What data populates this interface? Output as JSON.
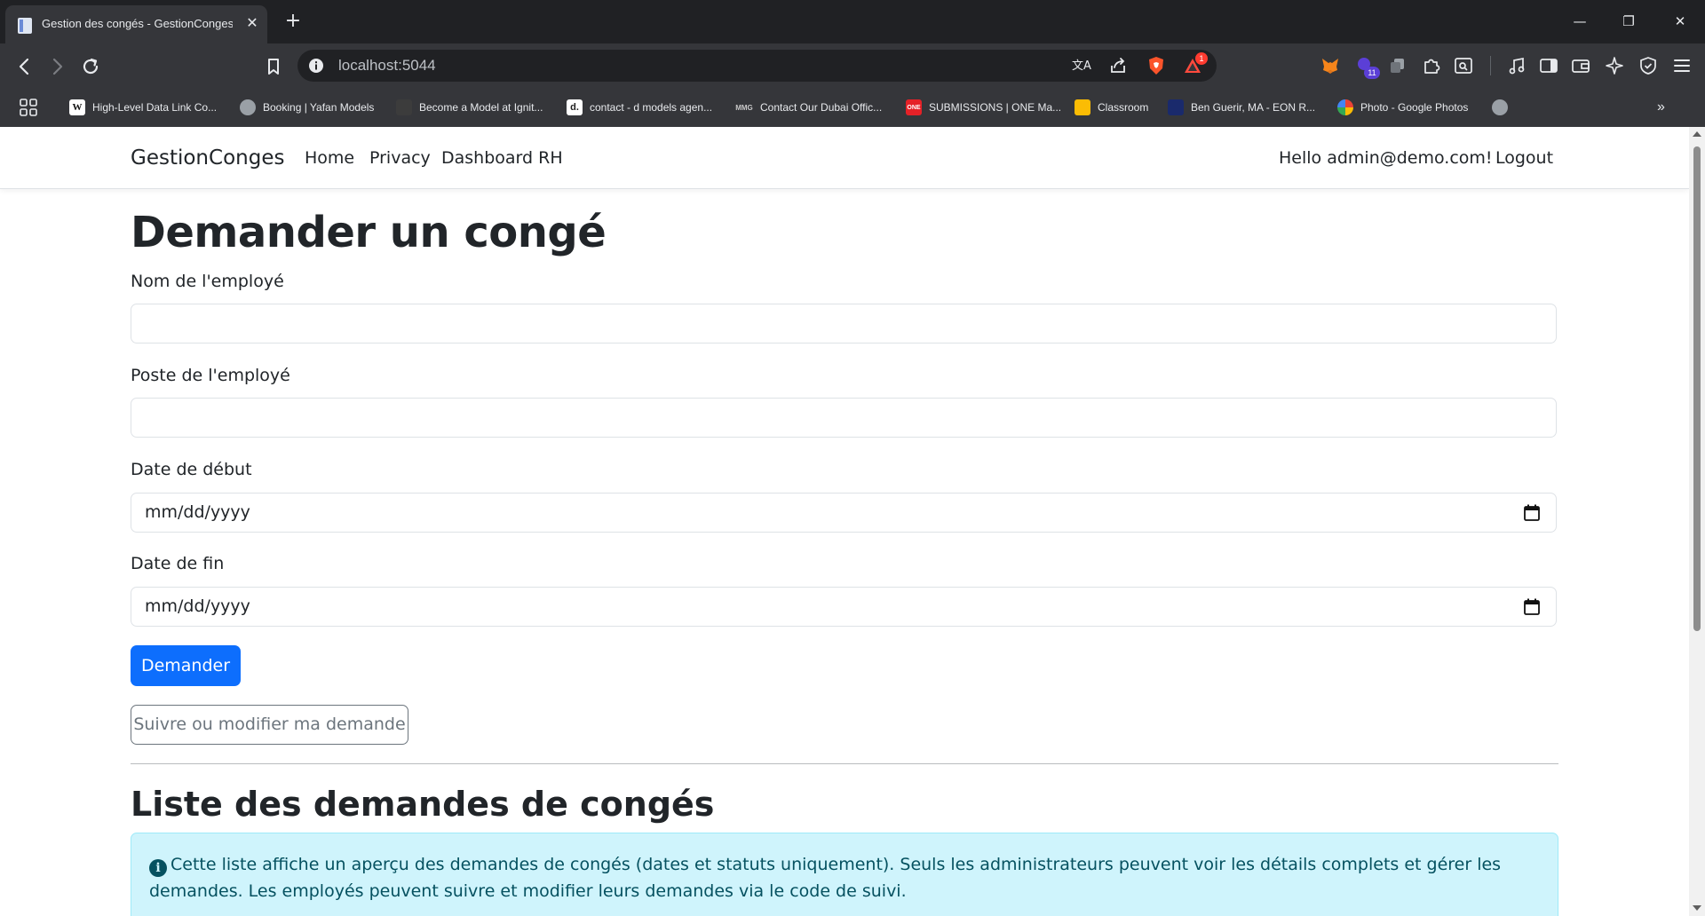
{
  "browser": {
    "tab_title": "Gestion des congés - GestionConges",
    "url": "localhost:5044",
    "notification_count": "1",
    "extension_badge": "11",
    "bookmarks": [
      {
        "label": "High-Level Data Link Co...",
        "icon": "wikipedia-icon"
      },
      {
        "label": "Booking | Yafan Models",
        "icon": "globe-icon"
      },
      {
        "label": "Become a Model at Ignit...",
        "icon": "ignite-icon"
      },
      {
        "label": "contact - d models agen...",
        "icon": "d-models-icon"
      },
      {
        "label": "Contact Our Dubai Offic...",
        "icon": "mmg-icon"
      },
      {
        "label": "SUBMISSIONS | ONE Ma...",
        "icon": "one-icon"
      },
      {
        "label": "Classroom",
        "icon": "classroom-icon"
      },
      {
        "label": "Ben Guerir, MA - EON R...",
        "icon": "eon-icon"
      },
      {
        "label": "Photo - Google Photos",
        "icon": "google-photos-icon"
      }
    ]
  },
  "navbar": {
    "brand": "GestionConges",
    "links": [
      "Home",
      "Privacy",
      "Dashboard RH"
    ],
    "greeting": "Hello admin@demo.com!",
    "logout": "Logout"
  },
  "form": {
    "title": "Demander un congé",
    "employee_name_label": "Nom de l'employé",
    "employee_name_value": "",
    "employee_position_label": "Poste de l'employé",
    "employee_position_value": "",
    "start_date_label": "Date de début",
    "start_date_placeholder": "mm/dd/yyyy",
    "end_date_label": "Date de fin",
    "end_date_placeholder": "mm/dd/yyyy",
    "submit_label": "Demander",
    "track_label": "Suivre ou modifier ma demande"
  },
  "list": {
    "title": "Liste des demandes de congés",
    "info_text": "Cette liste affiche un aperçu des demandes de congés (dates et statuts uniquement). Seuls les administrateurs peuvent voir les détails complets et gérer les demandes. Les employés peuvent suivre et modifier leurs demandes via le code de suivi."
  },
  "colors": {
    "primary": "#0d6efd",
    "info_bg": "#cff4fc",
    "info_text": "#055160",
    "chrome_dark": "#202124",
    "chrome": "#35363a"
  }
}
